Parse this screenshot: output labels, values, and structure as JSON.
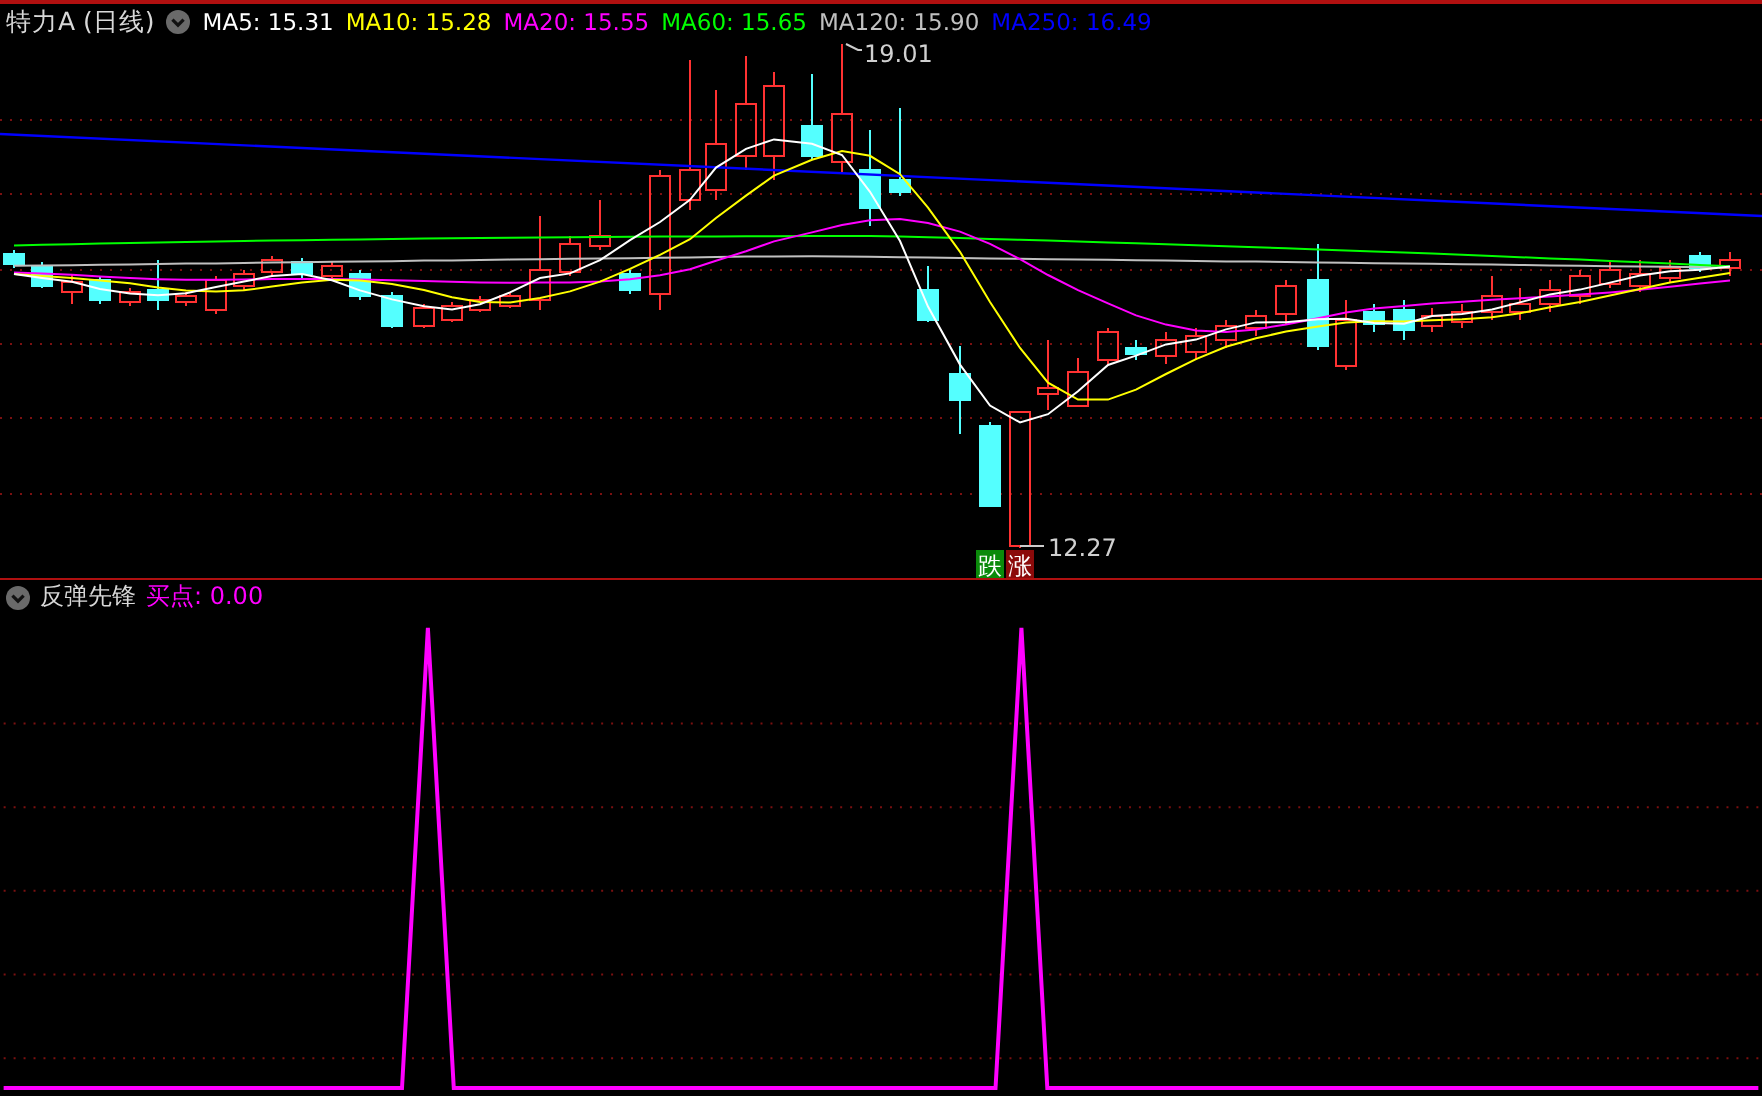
{
  "main_chart": {
    "title": "特力A (日线)",
    "ma_legend": [
      {
        "label": "MA5: 15.31",
        "color": "#ffffff"
      },
      {
        "label": "MA10: 15.28",
        "color": "#ffff00"
      },
      {
        "label": "MA20: 15.55",
        "color": "#ff00ff"
      },
      {
        "label": "MA60: 15.65",
        "color": "#00ff00"
      },
      {
        "label": "MA120: 15.90",
        "color": "#c0c0c0"
      },
      {
        "label": "MA250: 16.49",
        "color": "#0000ff"
      }
    ],
    "high_label": "19.01",
    "low_label": "12.27",
    "signal_badges": [
      {
        "label": "跌",
        "color": "#0a8a0a"
      },
      {
        "label": "涨",
        "color": "#8b0a0a"
      }
    ]
  },
  "indicator": {
    "name": "反弹先锋",
    "reading": "买点: 0.00"
  }
}
